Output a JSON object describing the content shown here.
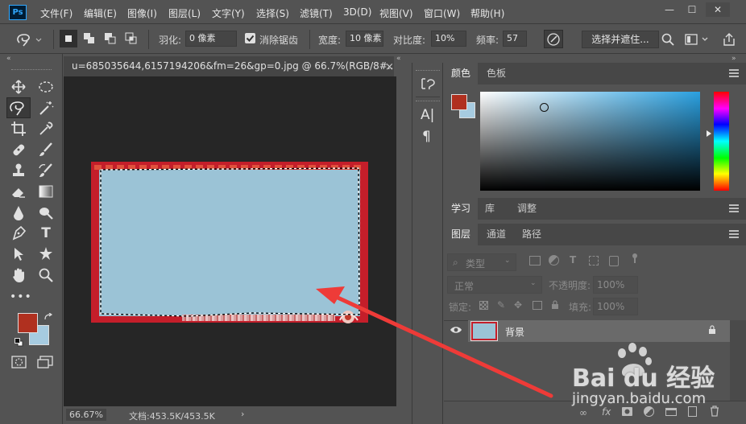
{
  "app": {
    "logo": "Ps"
  },
  "menu": [
    "文件(F)",
    "编辑(E)",
    "图像(I)",
    "图层(L)",
    "文字(Y)",
    "选择(S)",
    "滤镜(T)",
    "3D(D)",
    "视图(V)",
    "窗口(W)",
    "帮助(H)"
  ],
  "window_controls": {
    "minimize": "—",
    "restore": "☐",
    "close": "✕"
  },
  "options": {
    "feather_label": "羽化:",
    "feather_value": "0 像素",
    "antialias_label": "消除锯齿",
    "antialias_checked": true,
    "width_label": "宽度:",
    "width_value": "10 像素",
    "contrast_label": "对比度:",
    "contrast_value": "10%",
    "frequency_label": "频率:",
    "frequency_value": "57",
    "select_mask_label": "选择并遮住..."
  },
  "document": {
    "tab_title": "u=685035644,6157194206&fm=26&gp=0.jpg @ 66.7%(RGB/8#...",
    "tab_close": "×",
    "zoom": "66.67%",
    "doc_size": "文档:453.5K/453.5K",
    "status_arrow": "›"
  },
  "colors": {
    "foreground": "#b0301f",
    "background": "#a6cbe0",
    "canvas_fill": "#9bc3d6",
    "frame_red": "#c41e2a"
  },
  "panels": {
    "color_tabs": [
      "颜色",
      "色板"
    ],
    "learn_tabs": [
      "学习",
      "库",
      "调整"
    ],
    "layer_tabs": [
      "图层",
      "通道",
      "路径"
    ],
    "filter_kind": "类型",
    "blend_mode": "正常",
    "opacity_label": "不透明度:",
    "opacity_value": "100%",
    "lock_label": "锁定:",
    "fill_label": "填充:",
    "fill_value": "100%",
    "layer_name": "背景"
  },
  "watermark": {
    "brand": "Bai du 经验",
    "url": "jingyan.baidu.com"
  }
}
